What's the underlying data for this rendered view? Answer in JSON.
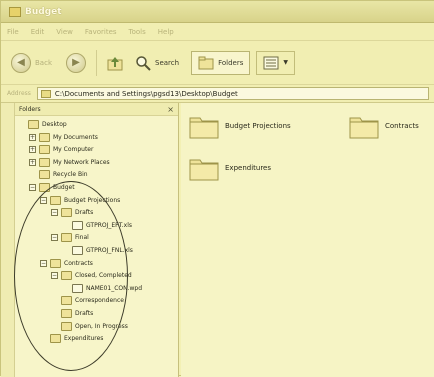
{
  "window": {
    "title": "Budget"
  },
  "menu": [
    "File",
    "Edit",
    "View",
    "Favorites",
    "Tools",
    "Help"
  ],
  "toolbar": {
    "back_label": "Back",
    "search_label": "Search",
    "folders_label": "Folders"
  },
  "address": {
    "label": "Address",
    "value": "C:\\Documents and Settings\\pgsd13\\Desktop\\Budget"
  },
  "folders_pane": {
    "title": "Folders",
    "close": "×",
    "tree": [
      {
        "label": "Desktop",
        "level": 0,
        "exp": ""
      },
      {
        "label": "My Documents",
        "level": 1,
        "exp": "+"
      },
      {
        "label": "My Computer",
        "level": 1,
        "exp": "+"
      },
      {
        "label": "My Network Places",
        "level": 1,
        "exp": "+"
      },
      {
        "label": "Recycle Bin",
        "level": 1,
        "exp": ""
      },
      {
        "label": "Budget",
        "level": 1,
        "exp": "−"
      },
      {
        "label": "Budget Projections",
        "level": 2,
        "exp": "−"
      },
      {
        "label": "Drafts",
        "level": 3,
        "exp": "−"
      },
      {
        "label": "GTPROJ_EPT.xls",
        "level": 4,
        "exp": ""
      },
      {
        "label": "Final",
        "level": 3,
        "exp": "−"
      },
      {
        "label": "GTPROJ_FNL.xls",
        "level": 4,
        "exp": ""
      },
      {
        "label": "Contracts",
        "level": 2,
        "exp": "−"
      },
      {
        "label": "Closed, Completed",
        "level": 3,
        "exp": "−"
      },
      {
        "label": "NAME01_CON.wpd",
        "level": 4,
        "exp": ""
      },
      {
        "label": "Correspondence",
        "level": 3,
        "exp": ""
      },
      {
        "label": "Drafts",
        "level": 3,
        "exp": ""
      },
      {
        "label": "Open, In Progress",
        "level": 3,
        "exp": ""
      },
      {
        "label": "Expenditures",
        "level": 2,
        "exp": ""
      }
    ]
  },
  "content": {
    "folders": [
      {
        "label": "Budget Projections"
      },
      {
        "label": "Contracts"
      },
      {
        "label": "Expenditures"
      }
    ]
  },
  "colors": {
    "tint": "#f3f0b4",
    "folder": "#efe39a",
    "outline": "#9e9449"
  },
  "icons": {
    "back": "back-arrow-icon",
    "forward": "forward-arrow-icon",
    "up": "up-folder-icon",
    "search": "search-icon",
    "folders": "folders-icon",
    "views": "views-icon"
  }
}
